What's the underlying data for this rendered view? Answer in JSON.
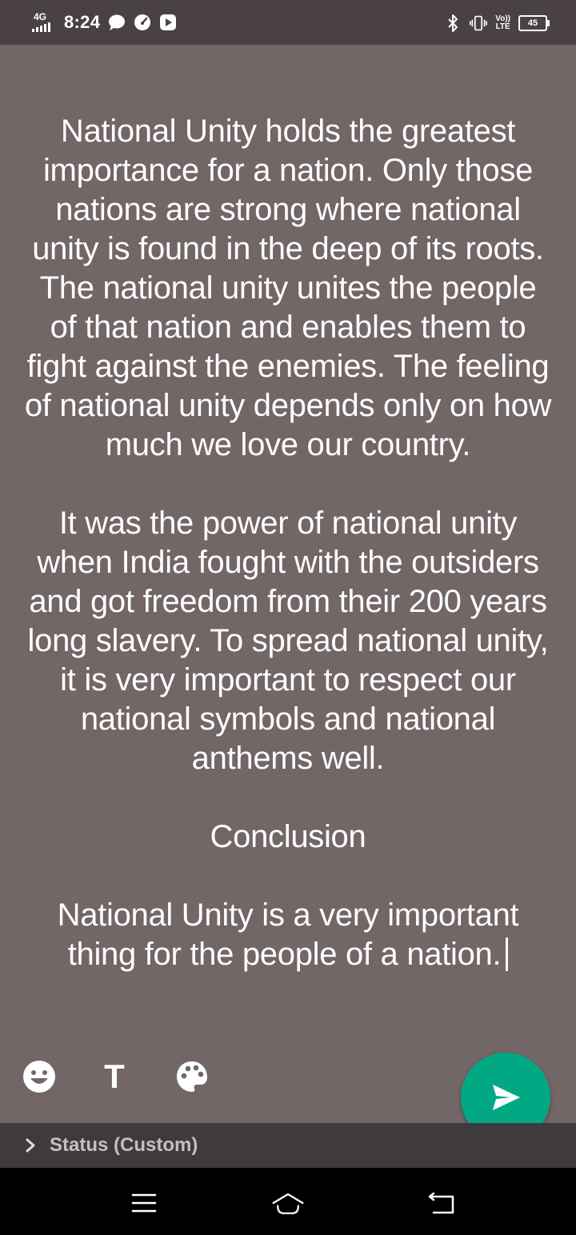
{
  "status_bar": {
    "network": "4G",
    "time": "8:24",
    "volte_top": "Vo))",
    "volte_bottom": "LTE",
    "battery": "45",
    "icons": [
      "chat-bubble-icon",
      "speedometer-icon",
      "play-store-icon",
      "bluetooth-icon",
      "vibrate-icon"
    ]
  },
  "status_text": {
    "content": "National Unity holds the greatest importance for a nation. Only those nations are strong where national unity is found in the deep of its roots. The national unity unites the people of that nation and enables them to fight against the enemies. The feeling of national unity depends only on how much we love our country.\n\nIt was the power of national unity when India fought with the outsiders and got freedom from their 200 years long slavery. To spread national unity, it is very important to respect our national symbols and national anthems well.\n\nConclusion\n\nNational Unity is a very important thing for the people of a nation."
  },
  "toolbar": {
    "emoji_icon": "emoji-icon",
    "text_tool_label": "T",
    "palette_icon": "palette-icon",
    "send_icon": "send-icon",
    "accent_color": "#00a884"
  },
  "audience": {
    "label": "Status (Custom)"
  },
  "nav": {
    "icons": [
      "recents-icon",
      "home-icon",
      "back-icon"
    ]
  },
  "colors": {
    "background": "#726667",
    "status_bar": "#4a4143",
    "caption_bar": "#3f3a3e"
  }
}
